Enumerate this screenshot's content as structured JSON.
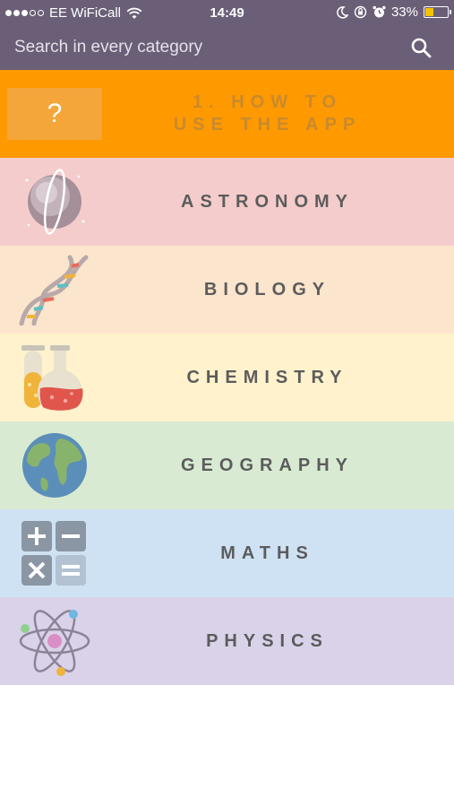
{
  "status_bar": {
    "signal_dots_filled": 3,
    "signal_dots_total": 5,
    "carrier": "EE WiFiCall",
    "time": "14:49",
    "battery_percent": "33%",
    "battery_level": 0.33,
    "icons": [
      "wifi-icon",
      "moon-icon",
      "rotation-lock-icon",
      "alarm-icon",
      "battery-icon"
    ]
  },
  "search": {
    "placeholder": "Search in every category",
    "icon": "search-icon"
  },
  "categories": [
    {
      "id": "howto",
      "label": "1. HOW TO USE THE APP",
      "line1": "1.  HOW TO",
      "line2": "USE THE APP",
      "icon_char": "?",
      "color": "#ff9900"
    },
    {
      "id": "astronomy",
      "label": "ASTRONOMY",
      "icon": "planet-icon",
      "color": "#f4cccc"
    },
    {
      "id": "biology",
      "label": "BIOLOGY",
      "icon": "dna-icon",
      "color": "#fce5cd"
    },
    {
      "id": "chemistry",
      "label": "CHEMISTRY",
      "icon": "flask-icon",
      "color": "#fff2cc"
    },
    {
      "id": "geography",
      "label": "GEOGRAPHY",
      "icon": "globe-icon",
      "color": "#d9ead3"
    },
    {
      "id": "maths",
      "label": "MATHS",
      "icon": "calculator-icon",
      "color": "#cfe2f3"
    },
    {
      "id": "physics",
      "label": "PHYSICS",
      "icon": "atom-icon",
      "color": "#d9d2e9"
    }
  ]
}
